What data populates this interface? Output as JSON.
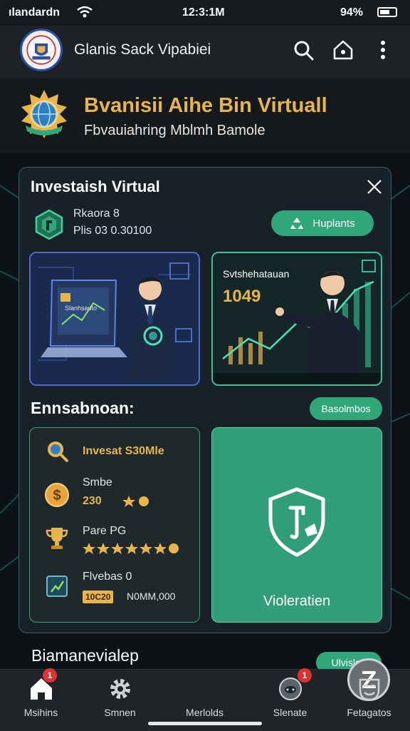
{
  "status_bar": {
    "carrier": "ılandardn",
    "time": "12:3:1M",
    "battery": "94%"
  },
  "app_bar": {
    "title": "Glanis Sack Vipabiei"
  },
  "hero": {
    "title": "Bvanisii Aihe Bin Virtuall",
    "subtitle": "Fbvauiahring Mblmh Bamole"
  },
  "card": {
    "title": "Investaish Virtual",
    "account_name": "Rkaora 8",
    "account_value": "Plis 03 0.30100",
    "primary_button": "Huplants",
    "left_image_screen_text": "Slanhsauto",
    "right_image_title": "Svtshehatauan",
    "right_image_value": "1049",
    "section_title": "Ennsabnoan:",
    "section_button": "Basolmbos",
    "list": [
      {
        "icon": "magnifier-award-icon",
        "label": "Invesat S30Mle",
        "accent": true
      },
      {
        "icon": "dollar-coin-icon",
        "label": "Smbe",
        "sub": "230"
      },
      {
        "icon": "trophy-icon",
        "label": "Pare PG"
      },
      {
        "icon": "document-chart-icon",
        "label": "Flvebas 0",
        "sub_tag": "10C20",
        "sub": "N0MM,000"
      }
    ],
    "green_panel_caption": "Violeratien"
  },
  "below": {
    "title": "Biamanevialep",
    "button": "Ulvislau"
  },
  "bottom_nav": {
    "items": [
      {
        "label": "Msihins",
        "icon": "home-icon",
        "badge": "1"
      },
      {
        "label": "Smnen",
        "icon": "gear-icon"
      },
      {
        "label": "Merlolds",
        "icon": "z-logo-icon"
      },
      {
        "label": "Slenate",
        "icon": "globe-chat-icon",
        "badge": "1"
      },
      {
        "label": "Fetagatos",
        "icon": "mask-icon"
      }
    ]
  },
  "colors": {
    "accent_green": "#2fa77b",
    "gold": "#e8b54a",
    "badge_red": "#e03131"
  }
}
